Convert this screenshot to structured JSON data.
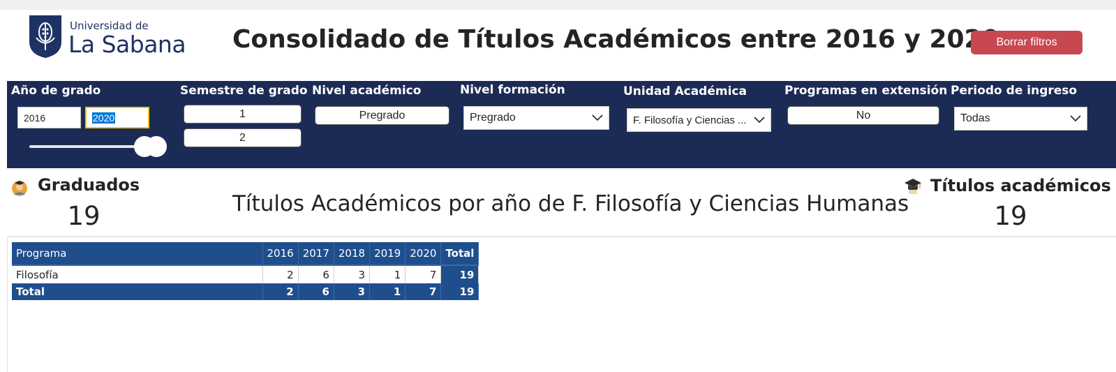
{
  "header": {
    "logo_small": "Universidad de",
    "logo_big": "La Sabana",
    "title": "Consolidado de Títulos Académicos entre 2016 y 2020",
    "clear_filters_label": "Borrar filtros"
  },
  "filters": {
    "year": {
      "label": "Año de grado",
      "from": "2016",
      "to": "2020"
    },
    "semester": {
      "label": "Semestre de grado",
      "options": [
        "1",
        "2"
      ]
    },
    "academic_level": {
      "label": "Nivel académico",
      "value": "Pregrado"
    },
    "training_level": {
      "label": "Nivel formación",
      "value": "Pregrado"
    },
    "academic_unit": {
      "label": "Unidad Académica",
      "value": "F. Filosofía y Ciencias ..."
    },
    "extension": {
      "label": "Programas en extensión",
      "value": "No"
    },
    "entry_period": {
      "label": "Periodo de ingreso",
      "value": "Todas"
    }
  },
  "kpis": {
    "graduates": {
      "label": "Graduados",
      "value": "19",
      "icon": "graduate-icon"
    },
    "titles": {
      "label": "Títulos académicos",
      "value": "19",
      "icon": "graduation-cap-icon"
    }
  },
  "chart_title": "Títulos Académicos por año de F. Filosofía y Ciencias Humanas",
  "table": {
    "headers": [
      "Programa",
      "2016",
      "2017",
      "2018",
      "2019",
      "2020",
      "Total"
    ],
    "rows": [
      [
        "Filosofía",
        "2",
        "6",
        "3",
        "1",
        "7",
        "19"
      ]
    ],
    "total": [
      "Total",
      "2",
      "6",
      "3",
      "1",
      "7",
      "19"
    ]
  },
  "colors": {
    "filter_bar": "#1c2b56",
    "table_header": "#1f4e8c",
    "clear_button": "#c8484f",
    "brand": "#1e3264"
  }
}
